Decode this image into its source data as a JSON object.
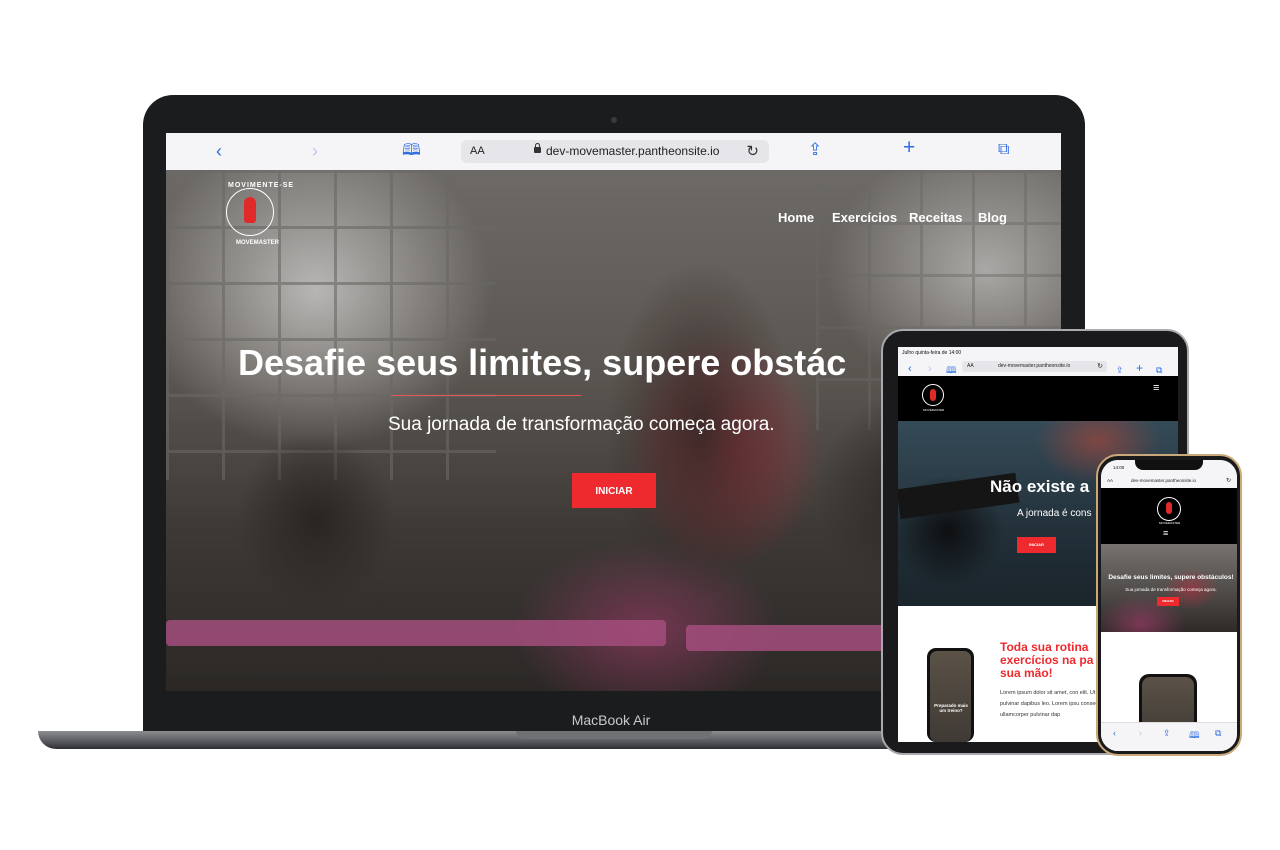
{
  "laptop": {
    "browser": {
      "url_aa": "AA",
      "url": "dev-movemaster.pantheonsite.io",
      "icons": [
        "back-icon",
        "forward-icon",
        "bookmarks-icon",
        "reload-icon",
        "share-icon",
        "new-tab-icon",
        "tabs-icon"
      ]
    },
    "logo": {
      "arc_text": "MOVIMENTE-SE",
      "sub_text": "MOVEMASTER"
    },
    "nav": [
      "Home",
      "Exercícios",
      "Receitas",
      "Blog"
    ],
    "hero": {
      "title": "Desafie seus limites, supere obstác",
      "subtitle": "Sua jornada de transformação começa agora.",
      "cta": "INICIAR"
    },
    "base_label": "MacBook Air"
  },
  "tablet": {
    "status": "Julho quinta-feira de 14:00",
    "url": "dev-movemaster.pantheonsite.io",
    "url_aa": "AA",
    "logo_sub": "MOVEMASTER",
    "hero": {
      "title": "Não existe a",
      "subtitle": "A jornada é cons",
      "cta": "INICIAR"
    },
    "phone_caption": "Preparado mais um treino?",
    "section_title": "Toda sua rotina\nexercícios na pa\nsua mão!",
    "section_text": "Lorem ipsum dolor sit amet, con elit. Ut elit tellus, luctus nec ullan pulvinar dapibus leo. Lorem ipsu consectetur adipiscing elit. Ut el ullamcorper pulvinar dap"
  },
  "phone": {
    "time": "14:00",
    "url_aa": "AA",
    "url": "dev-movemaster.pantheonsite.io",
    "logo_sub": "MOVEMASTER",
    "hero": {
      "title": "Desafie seus limites, supere obstáculos!",
      "subtitle": "Sua jornada de transformação começa agora.",
      "cta": "INICIAR"
    }
  },
  "colors": {
    "accent": "#ee2a2f",
    "link": "#2d6cdf",
    "device_frame": "#1b1c1e"
  }
}
